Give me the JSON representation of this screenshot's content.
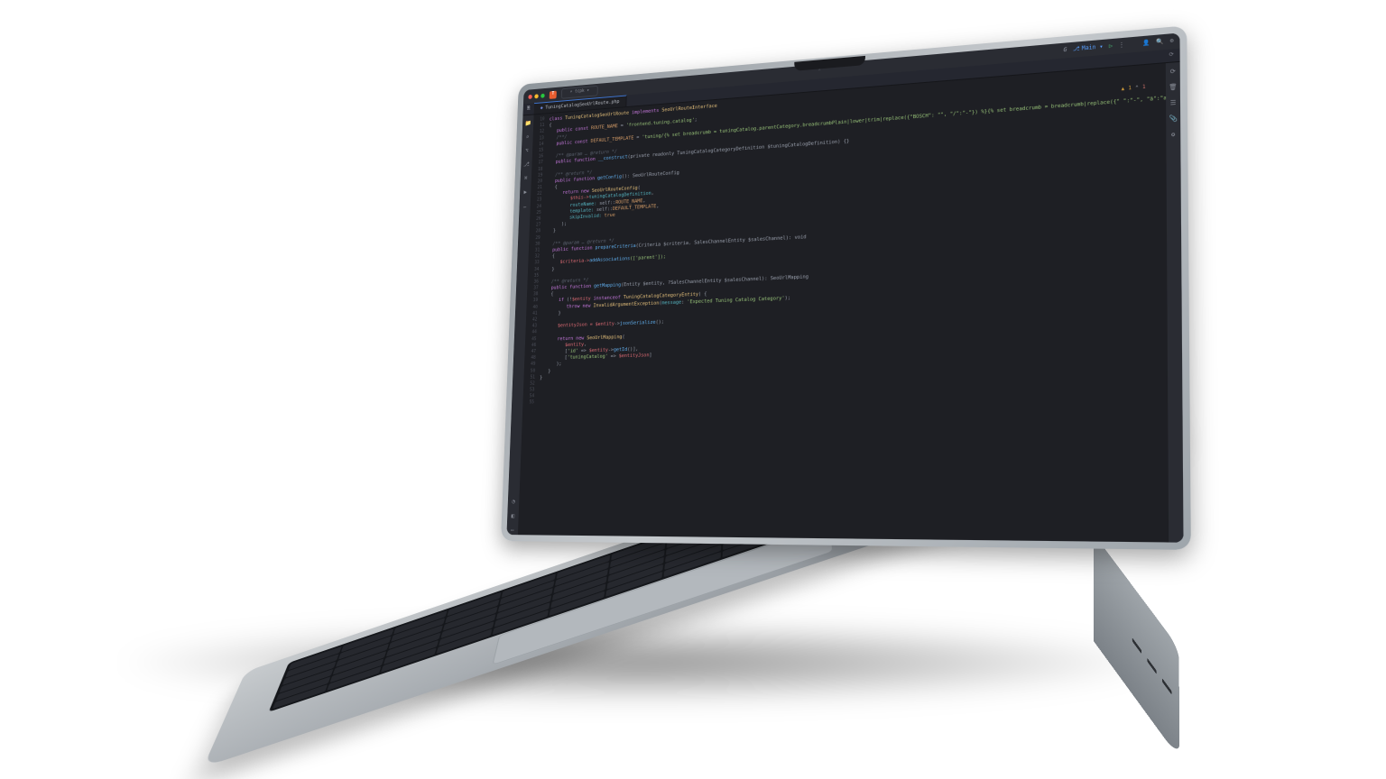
{
  "titlebar": {
    "workspace_initial": "T",
    "search_placeholder": "tcpk ▾",
    "gpt_label": "G",
    "branch_icon": "⎇",
    "branch_name": "Main ▾",
    "run_glyph": "▷",
    "more_glyph": "⋮",
    "user_glyph": "👤",
    "search_glyph": "🔍",
    "settings_glyph": "⚙"
  },
  "tab": {
    "icon_glyph": "◆",
    "filename": "TuningCatalogSeoUrlRoute.php",
    "reload_glyph": "⟳"
  },
  "left_icons": [
    "📁",
    "⌕",
    "⌥",
    "⎇",
    "⌘",
    "▶",
    "…"
  ],
  "left_icons_bottom": [
    "◔",
    "◧",
    "⋯"
  ],
  "right_icons": [
    "⟳",
    "🗑",
    "☰",
    "📎",
    "✪"
  ],
  "problems": {
    "warn_glyph": "▲",
    "warn_count": "1",
    "err_sep": "⌃",
    "err_count": "1"
  },
  "lines": {
    "start": 10,
    "count": 46
  },
  "code": {
    "l1": {
      "pre": "class ",
      "cls": "TuningCatalogSeoUrlRoute",
      "mid": " implements ",
      "iface": "SeoUrlRouteInterface"
    },
    "l2": "{",
    "l3": {
      "mods": "public const ",
      "name": "ROUTE_NAME",
      "eq": " = ",
      "val": "'frontend.tuning.catalog'",
      "end": ";"
    },
    "l4": "/**/",
    "l5": {
      "mods": "public const ",
      "name": "DEFAULT_TEMPLATE",
      "eq": " = ",
      "val": "'tuning/{% set breadcrumb = tuningCatalog.parentCategory.breadcrumbPlain|lower|trim|replace({\"BOSCH\": \"\", \"/\":\"-\"}) %}{% set breadcrumb = breadcrumb|replace({\" \":\"-\", \"ä\":\"ae\", \"ö\":\"oe\", \"ü\":\"ue\", \"ß\"'",
      "end": ";"
    },
    "l6": "",
    "l7": {
      "cmt": "/** @param … @return */"
    },
    "l8": {
      "mods": "public function ",
      "fn": "__construct",
      "sig": "(private readonly TuningCatalogCategoryDefinition $tuningCatalogDefinition) {}"
    },
    "l9": "",
    "l10": {
      "cmt": "/** @return */"
    },
    "l11": {
      "mods": "public function ",
      "fn": "getConfig",
      "sig": "(): SeoUrlRouteConfig"
    },
    "l12": "{",
    "l13": {
      "kw": "return new ",
      "cls": "SeoUrlRouteConfig",
      "open": "("
    },
    "l14": {
      "a": "$this->",
      "b": "tuningCatalogDefinition",
      "end": ","
    },
    "l15": {
      "a": "routeName: ",
      "b": "self::",
      "c": "ROUTE_NAME",
      "end": ","
    },
    "l16": {
      "a": "template: ",
      "b": "self::",
      "c": "DEFAULT_TEMPLATE",
      "end": ","
    },
    "l17": {
      "a": "skipInvalid: ",
      "c": "true"
    },
    "l18": ");",
    "l19": "}",
    "l20": "",
    "l21": {
      "cmt": "/** @param … @return */"
    },
    "l22": {
      "mods": "public function ",
      "fn": "prepareCriteria",
      "sig": "(Criteria $criteria, SalesChannelEntity $salesChannel): void"
    },
    "l23": "{",
    "l24": {
      "a": "$criteria->",
      "fn": "addAssociations",
      "arg": "(['parent']);"
    },
    "l25": "}",
    "l26": "",
    "l27": {
      "cmt": "/** @return */"
    },
    "l28": {
      "mods": "public function ",
      "fn": "getMapping",
      "sig": "(Entity $entity, ?SalesChannelEntity $salesChannel): SeoUrlMapping"
    },
    "l29": "{",
    "l30": {
      "kw": "if ",
      "open": "(!",
      "var": "$entity",
      "mid": " instanceof ",
      "cls": "TuningCatalogCategoryEntity",
      "close": ") {"
    },
    "l31": {
      "kw": "throw new ",
      "cls": "InvalidArgumentException",
      "open": "(",
      "msgfn": "message",
      "str": "'Expected Tuning Catalog Category'",
      "close": ");"
    },
    "l32": "}",
    "l33": "",
    "l34": {
      "a": "$entityJson = ",
      "var": "$entity",
      "b": "->",
      "fn": "jsonSerialize",
      "end": "();"
    },
    "l35": "",
    "l36": {
      "kw": "return new ",
      "cls": "SeoUrlMapping",
      "open": "("
    },
    "l37": {
      "var": "$entity",
      "end": ","
    },
    "l38": {
      "open": "[",
      "k": "'id'",
      "arr": " => ",
      "var": "$entity",
      "b": "->",
      "fn": "getId",
      "call": "()",
      "close": "],"
    },
    "l39": {
      "open": "[",
      "k": "'tuningCatalog'",
      "arr": " => ",
      "var": "$entityJson",
      "close": "]"
    },
    "l40": ");",
    "l41": "}",
    "l42": "}"
  }
}
